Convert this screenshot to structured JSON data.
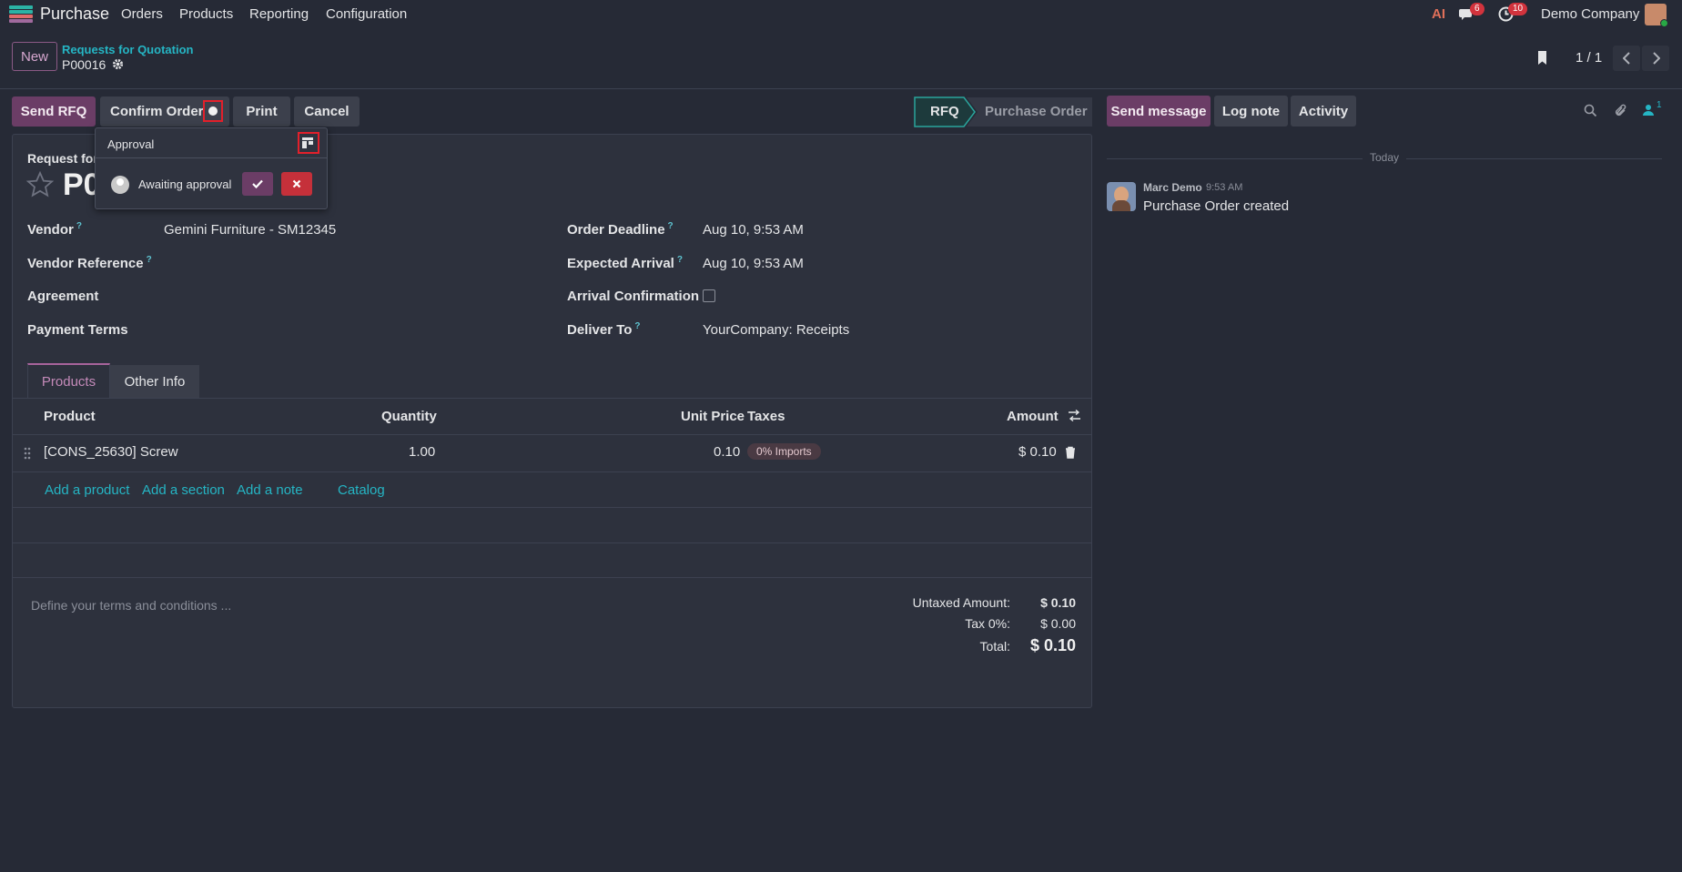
{
  "nav": {
    "app_name": "Purchase",
    "menu": [
      "Orders",
      "Products",
      "Reporting",
      "Configuration"
    ],
    "messages_badge": "6",
    "activity_badge": "10",
    "company": "Demo Company"
  },
  "control_panel": {
    "new_label": "New",
    "breadcrumb": "Requests for Quotation",
    "record_name": "P00016",
    "pager": "1 / 1"
  },
  "actions": {
    "send_rfq": "Send RFQ",
    "confirm_order": "Confirm Order",
    "print": "Print",
    "cancel": "Cancel"
  },
  "statusbar": {
    "rfq": "RFQ",
    "purchase_order": "Purchase Order"
  },
  "popover": {
    "title": "Approval",
    "status": "Awaiting approval"
  },
  "form": {
    "title_prefix": "Request for",
    "title_visible": "P0",
    "vendor_label": "Vendor",
    "vendor_value": "Gemini Furniture - SM12345",
    "vendor_ref_label": "Vendor Reference",
    "agreement_label": "Agreement",
    "payment_terms_label": "Payment Terms",
    "order_deadline_label": "Order Deadline",
    "order_deadline_value": "Aug 10, 9:53 AM",
    "expected_arrival_label": "Expected Arrival",
    "expected_arrival_value": "Aug 10, 9:53 AM",
    "arrival_confirmation_label": "Arrival Confirmation",
    "arrival_confirmation_checked": false,
    "deliver_to_label": "Deliver To",
    "deliver_to_value": "YourCompany: Receipts"
  },
  "tabs": [
    "Products",
    "Other Info"
  ],
  "lines": {
    "headers": {
      "product": "Product",
      "quantity": "Quantity",
      "unit_price": "Unit Price",
      "taxes": "Taxes",
      "amount": "Amount"
    },
    "rows": [
      {
        "product": "[CONS_25630] Screw",
        "quantity": "1.00",
        "unit_price": "0.10",
        "tax": "0% Imports",
        "amount": "$ 0.10"
      }
    ],
    "add_product": "Add a product",
    "add_section": "Add a section",
    "add_note": "Add a note",
    "catalog": "Catalog"
  },
  "terms_placeholder": "Define your terms and conditions ...",
  "totals": {
    "untaxed_label": "Untaxed Amount:",
    "untaxed_value": "$ 0.10",
    "tax_label": "Tax 0%:",
    "tax_value": "$ 0.00",
    "total_label": "Total:",
    "total_value": "$ 0.10"
  },
  "chatter": {
    "send_message": "Send message",
    "log_note": "Log note",
    "activity": "Activity",
    "followers_count": "1",
    "date_separator": "Today",
    "messages": [
      {
        "author": "Marc Demo",
        "time": "9:53 AM",
        "body": "Purchase Order created"
      }
    ]
  },
  "colors": {
    "background": "#262a36",
    "primary": "#6b3d66",
    "link": "#25b5c4",
    "highlight": "#e2202b"
  }
}
